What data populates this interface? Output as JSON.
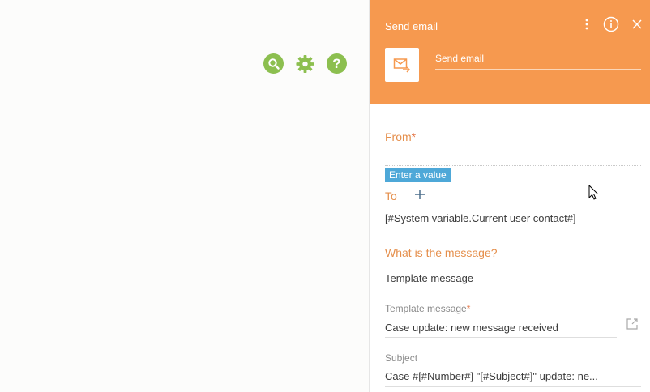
{
  "colors": {
    "accent_orange": "#f6994f",
    "label_orange": "#e58f4c",
    "green_icon": "#8cbf4f",
    "tooltip_blue": "#4ea8d8"
  },
  "toolbar": {
    "icons": [
      "search-icon",
      "gear-icon",
      "help-icon"
    ]
  },
  "panel": {
    "title": "Send email",
    "element_name": "Send email",
    "header_icons": [
      "more-vertical-icon",
      "info-icon",
      "close-icon"
    ]
  },
  "form": {
    "from_label": "From",
    "required_mark": "*",
    "from_value": "",
    "tooltip": "Enter a value",
    "to_label": "To",
    "to_value": "[#System variable.Current user contact#]",
    "message_question": "What is the message?",
    "message_type_value": "Template message",
    "template_label": "Template message",
    "template_value": "Case update: new message received",
    "subject_label": "Subject",
    "subject_value": "Case #[#Number#] \"[#Subject#]\" update: ne..."
  }
}
